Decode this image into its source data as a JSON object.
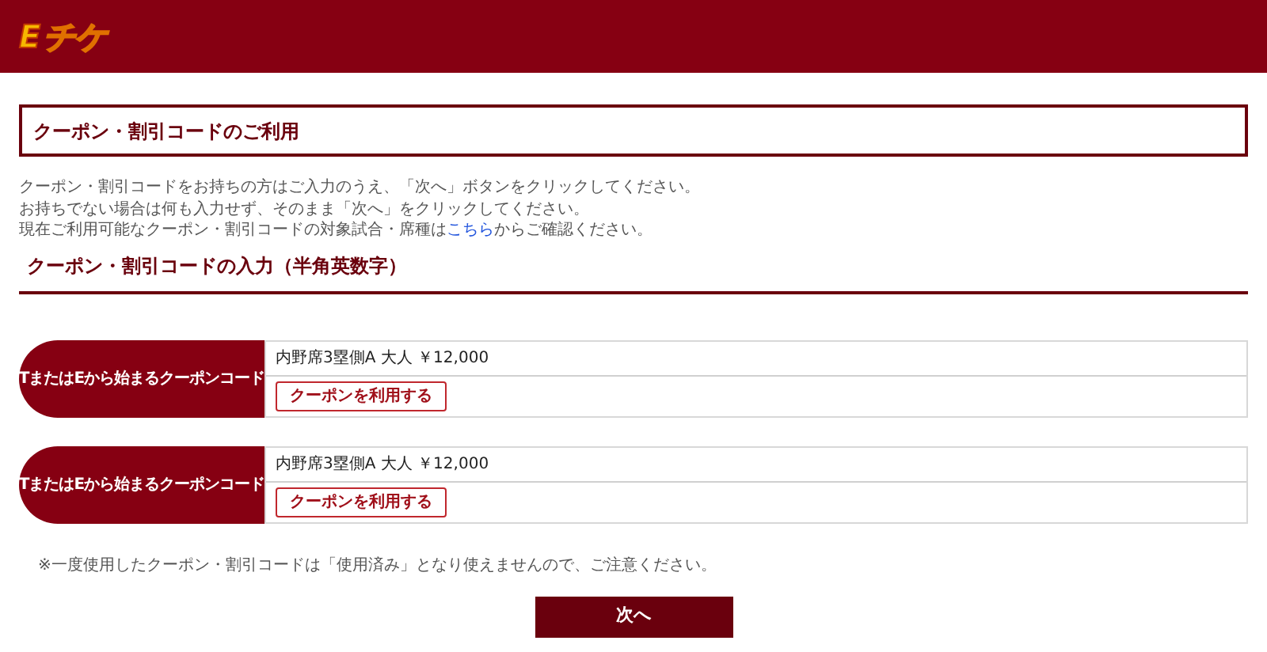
{
  "logo": {
    "mark": "E",
    "text": "チケ"
  },
  "page_title": "クーポン・割引コードのご利用",
  "intro": [
    "クーポン・割引コードをお持ちの方はご入力のうえ、「次へ」ボタンをクリックしてください。",
    "お持ちでない場合は何も入力せず、そのまま「次へ」をクリックしてください。"
  ],
  "availability": {
    "before": "現在ご利用可能なクーポン・割引コードの対象試合・席種は",
    "link": "こちら",
    "after": "からご確認ください。"
  },
  "section_heading": "クーポン・割引コードの入力（半角英数字）",
  "coupons": [
    {
      "label": "TまたはEから始まるクーポンコード",
      "ticket": "内野席3塁側A 大人 ￥12,000",
      "button": "クーポンを利用する"
    },
    {
      "label": "TまたはEから始まるクーポンコード",
      "ticket": "内野席3塁側A 大人 ￥12,000",
      "button": "クーポンを利用する"
    }
  ],
  "note": "※一度使用したクーポン・割引コードは「使用済み」となり使えませんので、ご注意ください。",
  "next_button": "次へ"
}
